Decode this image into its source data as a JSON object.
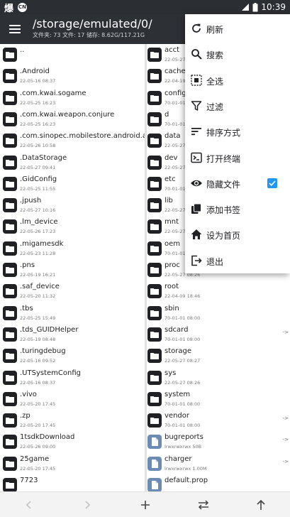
{
  "status_bar": {
    "app_glyph": "爆",
    "badge": "CN",
    "time": "10:39"
  },
  "header": {
    "path": "/storage/emulated/0/",
    "info": "文件夹: 73  文件: 17  储存: 8.62G/117.21G"
  },
  "left_list": [
    {
      "name": "..",
      "meta": ""
    },
    {
      "name": ".Android",
      "meta": "22-05-16 08:37"
    },
    {
      "name": ".com.kwai.sogame",
      "meta": "22-05-25 16:23"
    },
    {
      "name": ".com.kwai.weapon.conjure",
      "meta": "22-05-25 16:23"
    },
    {
      "name": ".com.sinopec.mobilestore.android.app",
      "meta": "22-05-26 10:58"
    },
    {
      "name": ".DataStorage",
      "meta": "22-05-27 09:41"
    },
    {
      "name": ".GidConfig",
      "meta": "22-05-25 11:55"
    },
    {
      "name": ".jpush",
      "meta": "22-05-27 10:16"
    },
    {
      "name": ".lm_device",
      "meta": "22-05-26 17:23"
    },
    {
      "name": ".migamesdk",
      "meta": "22-05-23 11:28"
    },
    {
      "name": ".pns",
      "meta": "22-05-19 16:21"
    },
    {
      "name": ".saf_device",
      "meta": "22-05-20 11:32"
    },
    {
      "name": ".tbs",
      "meta": "22-05-25 15:49"
    },
    {
      "name": ".tds_GUIDHelper",
      "meta": "22-05-19 08:48"
    },
    {
      "name": ".turingdebug",
      "meta": "22-05-16 09:52"
    },
    {
      "name": ".UTSystemConfig",
      "meta": "22-05-16 08:37"
    },
    {
      "name": ".vivo",
      "meta": "22-05-20 17:45"
    },
    {
      "name": ".zp",
      "meta": "22-05-20 17:45"
    },
    {
      "name": "1tsdkDownload",
      "meta": "22-05-26 09:00"
    },
    {
      "name": "25game",
      "meta": "22-05-20 17:45"
    },
    {
      "name": "7723",
      "meta": ""
    }
  ],
  "right_list": [
    {
      "name": "acct",
      "meta": "22-05-27",
      "type": "folder",
      "link": ""
    },
    {
      "name": "cache",
      "meta": "22-04-19",
      "type": "folder",
      "link": ""
    },
    {
      "name": "config",
      "meta": "70-01-01",
      "type": "folder",
      "link": ""
    },
    {
      "name": "d",
      "meta": "70-01-01",
      "type": "folder",
      "link": ""
    },
    {
      "name": "data",
      "meta": "22-05-27",
      "type": "folder",
      "link": ""
    },
    {
      "name": "dev",
      "meta": "22-05-27",
      "type": "folder",
      "link": ""
    },
    {
      "name": "etc",
      "meta": "70-01-01",
      "type": "folder",
      "link": ""
    },
    {
      "name": "lib",
      "meta": "22-05-27",
      "type": "folder",
      "link": ""
    },
    {
      "name": "mnt",
      "meta": "22-05-27",
      "type": "folder",
      "link": ""
    },
    {
      "name": "oem",
      "meta": "70-01-01",
      "type": "folder",
      "link": ""
    },
    {
      "name": "proc",
      "meta": "22-05-27 08:26",
      "type": "folder",
      "link": ""
    },
    {
      "name": "root",
      "meta": "22-04-09 18:46",
      "type": "folder",
      "link": ""
    },
    {
      "name": "sbin",
      "meta": "70-01-01 08:00",
      "type": "folder",
      "link": ""
    },
    {
      "name": "sdcard",
      "meta": "70-01-01 08:00",
      "type": "folder",
      "link": "->"
    },
    {
      "name": "storage",
      "meta": "22-05-27 08:27",
      "type": "folder",
      "link": ""
    },
    {
      "name": "sys",
      "meta": "22-05-27 08:26",
      "type": "folder",
      "link": ""
    },
    {
      "name": "system",
      "meta": "70-01-01 08:00",
      "type": "folder",
      "link": ""
    },
    {
      "name": "vendor",
      "meta": "70-01-01 08:00",
      "type": "folder",
      "link": "->"
    },
    {
      "name": "bugreports",
      "meta": "lrwxrwxrwx  50B",
      "type": "file",
      "link": "->"
    },
    {
      "name": "charger",
      "meta": "lrwxrwxrwx  1.00M",
      "type": "file",
      "link": "->"
    },
    {
      "name": "default.prop",
      "meta": "",
      "type": "file",
      "link": ""
    }
  ],
  "menu": {
    "items": [
      {
        "label": "刷新",
        "icon": "refresh-icon"
      },
      {
        "label": "搜索",
        "icon": "search-icon"
      },
      {
        "label": "全选",
        "icon": "select-all-icon"
      },
      {
        "label": "过滤",
        "icon": "filter-icon"
      },
      {
        "label": "排序方式",
        "icon": "sort-icon"
      },
      {
        "label": "打开终端",
        "icon": "terminal-icon"
      },
      {
        "label": "隐藏文件",
        "icon": "eye-icon",
        "checked": true
      },
      {
        "label": "添加书签",
        "icon": "bookmark-icon"
      },
      {
        "label": "设为首页",
        "icon": "home-icon"
      },
      {
        "label": "退出",
        "icon": "exit-icon"
      }
    ]
  },
  "colors": {
    "toolbar": "#2d3035",
    "status_bar": "#2b2e33",
    "check": "#2196f3",
    "folder_icon": "#202124"
  }
}
